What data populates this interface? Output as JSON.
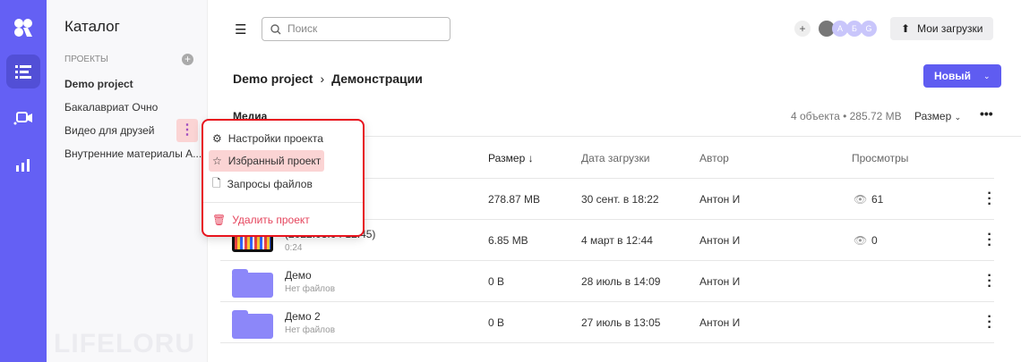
{
  "sidebar": {
    "title": "Каталог",
    "section": "ПРОЕКТЫ",
    "projects": [
      "Demo project",
      "Бакалавриат Очно",
      "Видео для друзей",
      "Внутренние материалы А..."
    ]
  },
  "watermark": "LIFELORU",
  "header": {
    "search_placeholder": "Поиск",
    "avatars": [
      "А",
      "Б",
      "G"
    ],
    "uploads": "Мои загрузки"
  },
  "breadcrumb": {
    "project": "Demo project",
    "sep": "›",
    "folder": "Демонстрации"
  },
  "new_button": "Новый",
  "media": {
    "label": "Медиа",
    "summary": "4 объекта • 285.72 MB",
    "sort": "Размер"
  },
  "columns": {
    "size": "Размер ↓",
    "date": "Дата загрузки",
    "author": "Автор",
    "views": "Просмотры"
  },
  "rows": [
    {
      "name": "",
      "sub": "",
      "size": "278.87 MB",
      "date": "30 сент. в 18:22",
      "author": "Антон И",
      "views": "61"
    },
    {
      "name": "(2022.03.04 12:45)",
      "sub": "0:24",
      "size": "6.85 MB",
      "date": "4 март в 12:44",
      "author": "Антон И",
      "views": "0"
    },
    {
      "name": "Демо",
      "sub": "Нет файлов",
      "size": "0 B",
      "date": "28 июль в 14:09",
      "author": "Антон И",
      "views": ""
    },
    {
      "name": "Демо 2",
      "sub": "Нет файлов",
      "size": "0 B",
      "date": "27 июль в 13:05",
      "author": "Антон И",
      "views": ""
    }
  ],
  "context_menu": {
    "settings": "Настройки проекта",
    "favorite": "Избранный проект",
    "requests": "Запросы файлов",
    "delete": "Удалить проект"
  },
  "colors": {
    "accent": "#6460f4",
    "danger": "#e5455d",
    "highlight": "#fbd4d4"
  }
}
